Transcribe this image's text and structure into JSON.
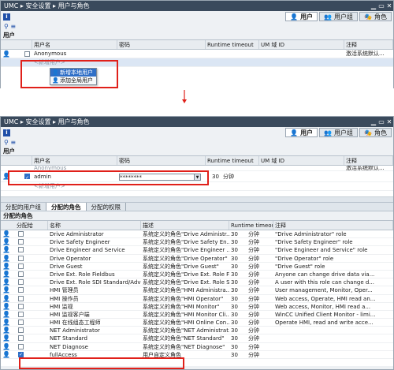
{
  "top": {
    "breadcrumb": [
      "UMC",
      "安全设置",
      "用户与角色"
    ],
    "tabs": [
      {
        "label": "用户",
        "active": true
      },
      {
        "label": "用户组",
        "active": false
      },
      {
        "label": "角色",
        "active": false
      }
    ],
    "section_title": "用户",
    "columns": [
      "用户名",
      "密码",
      "Runtime timeout",
      "UM 域 ID",
      "注释"
    ],
    "rows": [
      {
        "name": "Anonymous",
        "comment": "激活系统默认..."
      },
      {
        "name": "<新增用户>"
      }
    ],
    "context_menu": [
      "新增本地用户",
      "添加全局用户"
    ]
  },
  "bottom": {
    "breadcrumb": [
      "UMC",
      "安全设置",
      "用户与角色"
    ],
    "tabs": [
      {
        "label": "用户",
        "active": true
      },
      {
        "label": "用户组",
        "active": false
      },
      {
        "label": "角色",
        "active": false
      }
    ],
    "section_title": "用户",
    "columns": [
      "用户名",
      "密码",
      "Runtime timeout",
      "UM 域 ID",
      "注释"
    ],
    "rows": [
      {
        "name": "Anonymous",
        "comment": "激活系统默认..."
      },
      {
        "name": "admin",
        "password": "********",
        "timeout": "30",
        "unit": "分钟"
      },
      {
        "name": "<新增用户>"
      }
    ],
    "subtabs": [
      "分配的用户组",
      "分配的角色",
      "分配的权限"
    ],
    "assigned_title": "分配的角色",
    "role_columns": [
      "分配给",
      "名称",
      "描述",
      "Runtime timeout",
      "注释"
    ],
    "roles": [
      {
        "name": "Drive Administrator",
        "desc": "系统定义的角色\"Drive Administr...",
        "timeout": "30",
        "unit": "分钟",
        "comment": "\"Drive Administrator\" role",
        "checked": false
      },
      {
        "name": "Drive Safety Engineer",
        "desc": "系统定义的角色\"Drive Safety En...",
        "timeout": "30",
        "unit": "分钟",
        "comment": "\"Drive Safety Engineer\" role",
        "checked": false
      },
      {
        "name": "Drive Engineer and Service",
        "desc": "系统定义的角色\"Drive Engineer ...",
        "timeout": "30",
        "unit": "分钟",
        "comment": "\"Drive Engineer and Service\" role",
        "checked": false
      },
      {
        "name": "Drive Operator",
        "desc": "系统定义的角色\"Drive Operator\"",
        "timeout": "30",
        "unit": "分钟",
        "comment": "\"Drive Operator\" role",
        "checked": false
      },
      {
        "name": "Drive Guest",
        "desc": "系统定义的角色\"Drive Guest\"",
        "timeout": "30",
        "unit": "分钟",
        "comment": "\"Drive Guest\" role",
        "checked": false
      },
      {
        "name": "Drive Ext. Role Fieldbus",
        "desc": "系统定义的角色\"Drive Ext. Role F...",
        "timeout": "30",
        "unit": "分钟",
        "comment": "Anyone can change drive data via...",
        "checked": false
      },
      {
        "name": "Drive Ext. Role SDI Standard/Adv",
        "desc": "系统定义的角色\"Drive Ext. Role S...",
        "timeout": "30",
        "unit": "分钟",
        "comment": "A user with this role can change d...",
        "checked": false
      },
      {
        "name": "HMI 管理员",
        "desc": "系统定义的角色\"HMI Administra...",
        "timeout": "30",
        "unit": "分钟",
        "comment": "User management, Monitor, Oper...",
        "checked": false
      },
      {
        "name": "HMI 操作员",
        "desc": "系统定义的角色\"HMI Operator\"",
        "timeout": "30",
        "unit": "分钟",
        "comment": "Web access, Operate, HMI read an...",
        "checked": false
      },
      {
        "name": "HMI 监视",
        "desc": "系统定义的角色\"HMI Monitor\"",
        "timeout": "30",
        "unit": "分钟",
        "comment": "Web access, Monitor, HMI read a...",
        "checked": false
      },
      {
        "name": "HMI 监视客户端",
        "desc": "系统定义的角色\"HMI Monitor Cli...",
        "timeout": "30",
        "unit": "分钟",
        "comment": "WinCC Unified Client Monitor - limi...",
        "checked": false
      },
      {
        "name": "HMI 在线组态工程师",
        "desc": "系统定义的角色\"HMI Online Con...",
        "timeout": "30",
        "unit": "分钟",
        "comment": "Operate HMI, read and write acce...",
        "checked": false
      },
      {
        "name": "NET Administrator",
        "desc": "系统定义的角色\"NET Administrat...",
        "timeout": "30",
        "unit": "分钟",
        "comment": "",
        "checked": false
      },
      {
        "name": "NET Standard",
        "desc": "系统定义的角色\"NET Standard\"",
        "timeout": "30",
        "unit": "分钟",
        "comment": "",
        "checked": false
      },
      {
        "name": "NET Diagnose",
        "desc": "系统定义的角色\"NET Diagnose\"",
        "timeout": "30",
        "unit": "分钟",
        "comment": "",
        "checked": false
      },
      {
        "name": "fullAccess",
        "desc": "用户自定义角色",
        "timeout": "30",
        "unit": "分钟",
        "comment": "",
        "checked": true
      }
    ]
  },
  "colors": {
    "highlight": "#e0201a",
    "accent": "#2f6fc7",
    "titlebar": "#3a4a5c"
  }
}
